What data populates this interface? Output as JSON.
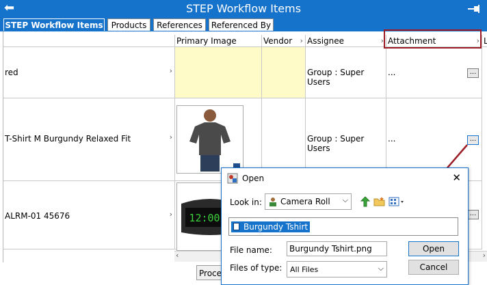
{
  "window": {
    "title": "STEP Workflow Items"
  },
  "tabs": [
    {
      "label": "STEP Workflow Items"
    },
    {
      "label": "Products"
    },
    {
      "label": "References"
    },
    {
      "label": "Referenced By"
    }
  ],
  "grid": {
    "columns": [
      "",
      "Primary Image",
      "Vendor",
      "Assignee",
      "Attachment",
      "L"
    ],
    "rows": [
      {
        "name": "red",
        "assignee": "Group : Super Users",
        "attachment": "..."
      },
      {
        "name": "T-Shirt M Burgundy Relaxed Fit",
        "assignee": "Group : Super Users",
        "attachment": "..."
      },
      {
        "name": "ALRM-01 45676",
        "assignee": "",
        "attachment": ""
      }
    ],
    "ellipsis_label": "...",
    "clock_display": "12:00"
  },
  "footer": {
    "proceed_label": "Proceed"
  },
  "dialog": {
    "title": "Open",
    "look_in_label": "Look in:",
    "look_in_value": "Camera Roll",
    "selected_item": "Burgundy Tshirt",
    "file_name_label": "File name:",
    "file_name_value": "Burgundy Tshirt.png",
    "file_type_label": "Files of type:",
    "file_type_value": "All Files",
    "open_label": "Open",
    "cancel_label": "Cancel"
  },
  "colors": {
    "titlebar": "#1673cb",
    "highlight": "#9b1c24",
    "yellow_cell": "#fffbc8"
  }
}
